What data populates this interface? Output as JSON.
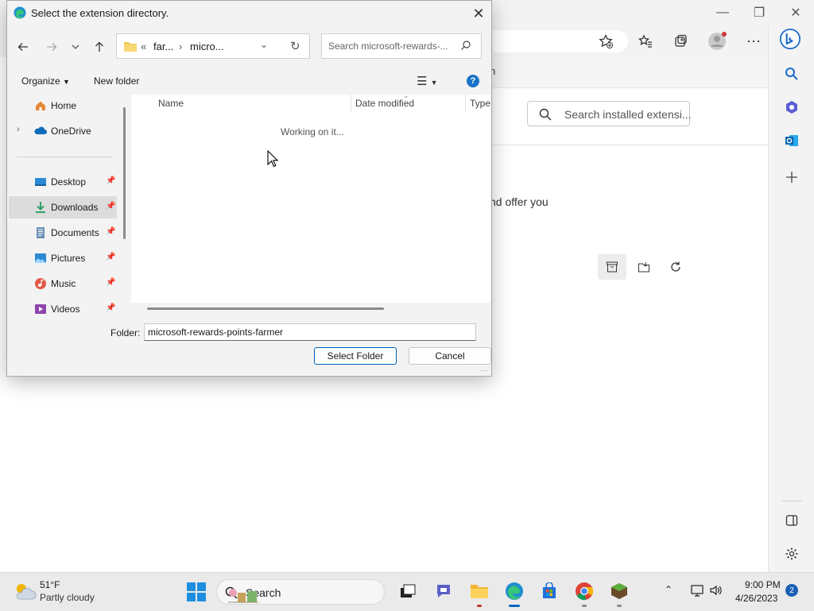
{
  "dialog": {
    "title": "Select the extension directory.",
    "breadcrumb": [
      "far...",
      "micro..."
    ],
    "search_placeholder": "Search microsoft-rewards-...",
    "organize_label": "Organize",
    "new_folder_label": "New folder",
    "nav_items": [
      {
        "label": "Home",
        "icon": "home-icon",
        "pinned": false
      },
      {
        "label": "OneDrive",
        "icon": "onedrive-icon",
        "pinned": false
      },
      {
        "label": "Desktop",
        "icon": "desktop-icon",
        "pinned": true
      },
      {
        "label": "Downloads",
        "icon": "download-icon",
        "pinned": true,
        "selected": true
      },
      {
        "label": "Documents",
        "icon": "documents-icon",
        "pinned": true
      },
      {
        "label": "Pictures",
        "icon": "pictures-icon",
        "pinned": true
      },
      {
        "label": "Music",
        "icon": "music-icon",
        "pinned": true
      },
      {
        "label": "Videos",
        "icon": "videos-icon",
        "pinned": true
      }
    ],
    "columns": [
      "Name",
      "Date modified",
      "Type"
    ],
    "status_text": "Working on it...",
    "folder_label": "Folder:",
    "folder_value": "microsoft-rewards-points-farmer",
    "select_button": "Select Folder",
    "cancel_button": "Cancel"
  },
  "browser": {
    "header_fragment": "n",
    "extensions_search_placeholder": "Search installed extensi...",
    "body_fragment": "nd offer you",
    "accent_color": "#0067c0"
  },
  "taskbar": {
    "weather_temp": "51°F",
    "weather_desc": "Partly cloudy",
    "search_label": "Search",
    "time": "9:00 PM",
    "date": "4/26/2023",
    "notification_count": "2"
  }
}
